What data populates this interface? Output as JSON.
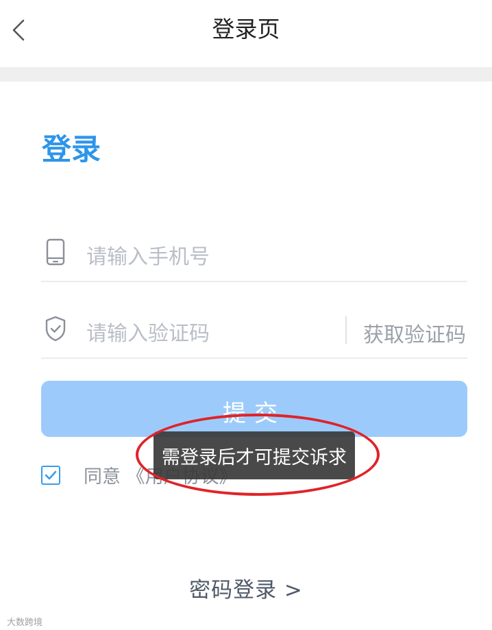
{
  "nav": {
    "title": "登录页",
    "back_icon": "chevron-left-icon"
  },
  "form": {
    "heading": "登录",
    "phone_placeholder": "请输入手机号",
    "code_placeholder": "请输入验证码",
    "get_code_label": "获取验证码",
    "submit_label": "提交",
    "agree_prefix": "同意",
    "agreement_link": "《用户协议》",
    "agree_checked": true,
    "password_login_label": "密码登录 >"
  },
  "toast": {
    "message": "需登录后才可提交诉求"
  },
  "colors": {
    "accent": "#2d95ea",
    "submit_disabled": "#9ccbfb",
    "annotation_ring": "#e02328"
  },
  "watermark": "大数跨境"
}
